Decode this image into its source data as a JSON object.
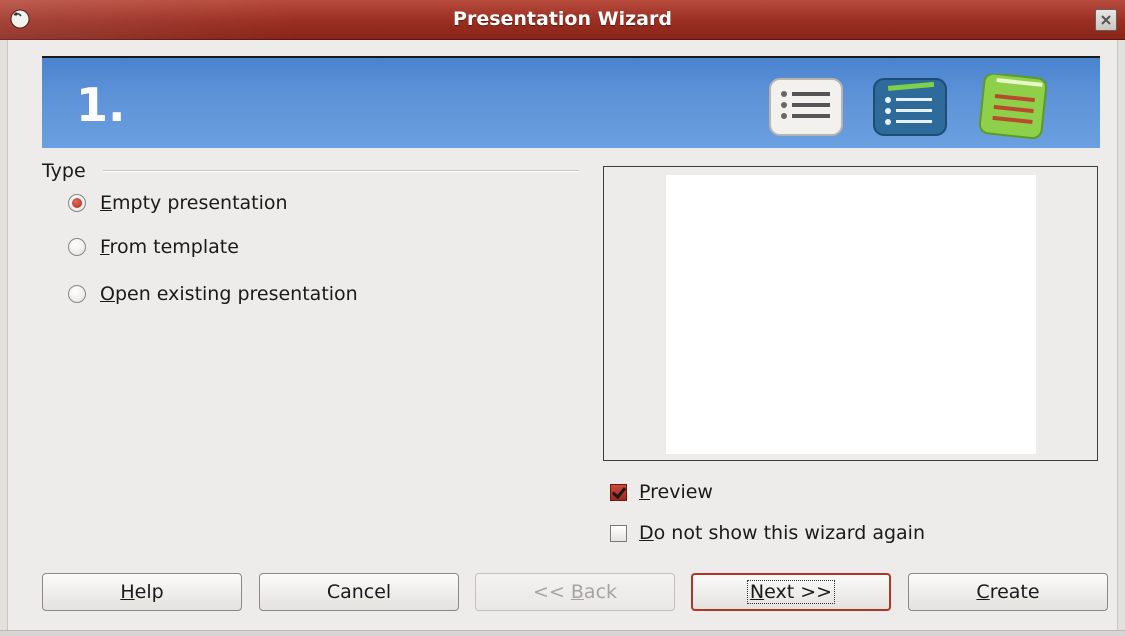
{
  "window": {
    "title": "Presentation Wizard",
    "title_color": "#9a2e22"
  },
  "banner": {
    "step": "1.",
    "color": "#5e93d8"
  },
  "type_group": {
    "label": "Type",
    "options": [
      {
        "accel": "E",
        "rest": "mpty presentation",
        "checked": true
      },
      {
        "accel": "F",
        "rest": "rom template",
        "checked": false
      },
      {
        "accel": "O",
        "rest": "pen existing presentation",
        "checked": false
      }
    ]
  },
  "preview_options": [
    {
      "accel": "P",
      "rest": "review",
      "checked": true
    },
    {
      "accel": "D",
      "rest": "o not show this wizard again",
      "checked": false
    }
  ],
  "buttons": {
    "help": {
      "accel": "H",
      "rest": "elp"
    },
    "cancel": {
      "label": "Cancel"
    },
    "back": {
      "pre": "<< ",
      "accel": "B",
      "rest": "ack",
      "enabled": false
    },
    "next": {
      "accel": "N",
      "rest": "ext >>",
      "default": true
    },
    "create": {
      "accel": "C",
      "rest": "reate"
    }
  }
}
